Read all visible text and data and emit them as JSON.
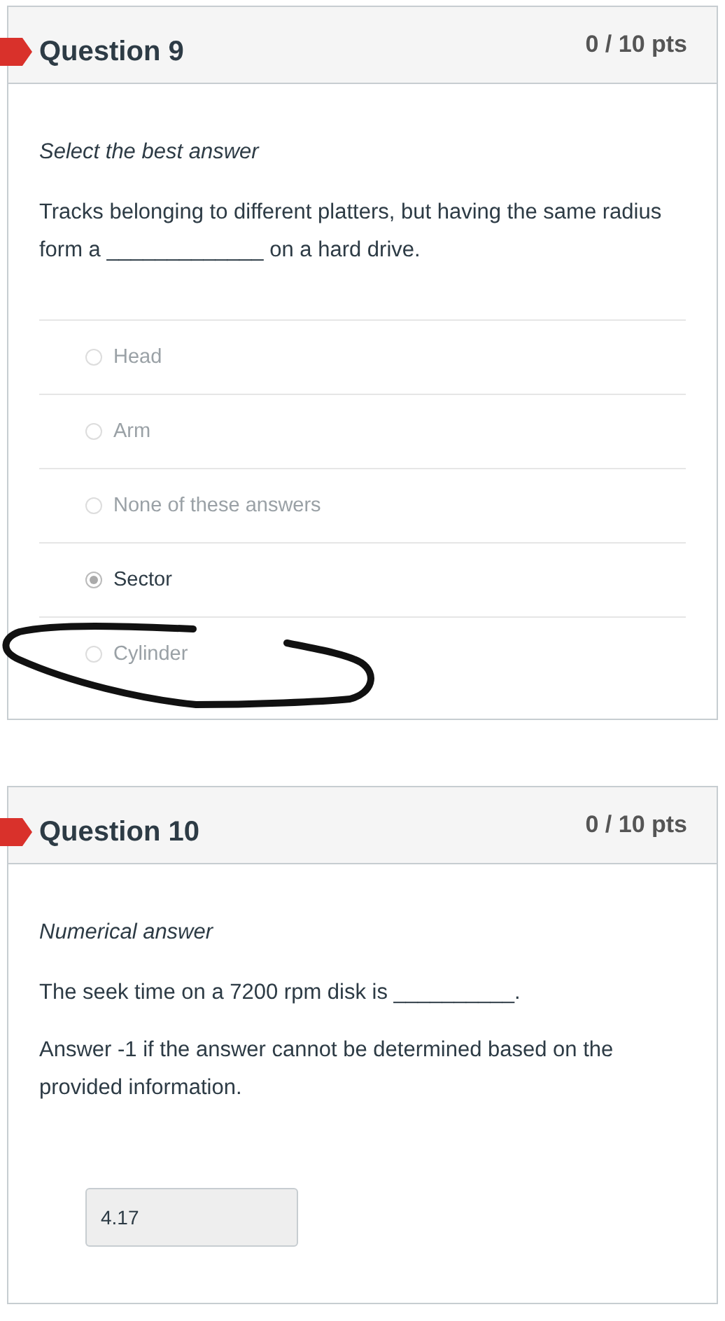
{
  "questions": [
    {
      "kind": "choice",
      "title": "Question 9",
      "points": "0 / 10 pts",
      "instruction": "Select the best answer",
      "prompt": "Tracks belonging to different platters, but having the same radius form a _____________ on a hard drive.",
      "options": [
        {
          "label": "Head",
          "selected": false,
          "circled": false
        },
        {
          "label": "Arm",
          "selected": false,
          "circled": false
        },
        {
          "label": "None of these answers",
          "selected": false,
          "circled": false
        },
        {
          "label": "Sector",
          "selected": true,
          "circled": false
        },
        {
          "label": "Cylinder",
          "selected": false,
          "circled": true
        }
      ]
    },
    {
      "kind": "numerical",
      "title": "Question 10",
      "points": "0 / 10 pts",
      "instruction": "Numerical answer",
      "prompt": "The seek time on a 7200 rpm disk is __________.",
      "note": "Answer -1 if the answer cannot be determined based on the provided information.",
      "answer": "4.17"
    }
  ]
}
